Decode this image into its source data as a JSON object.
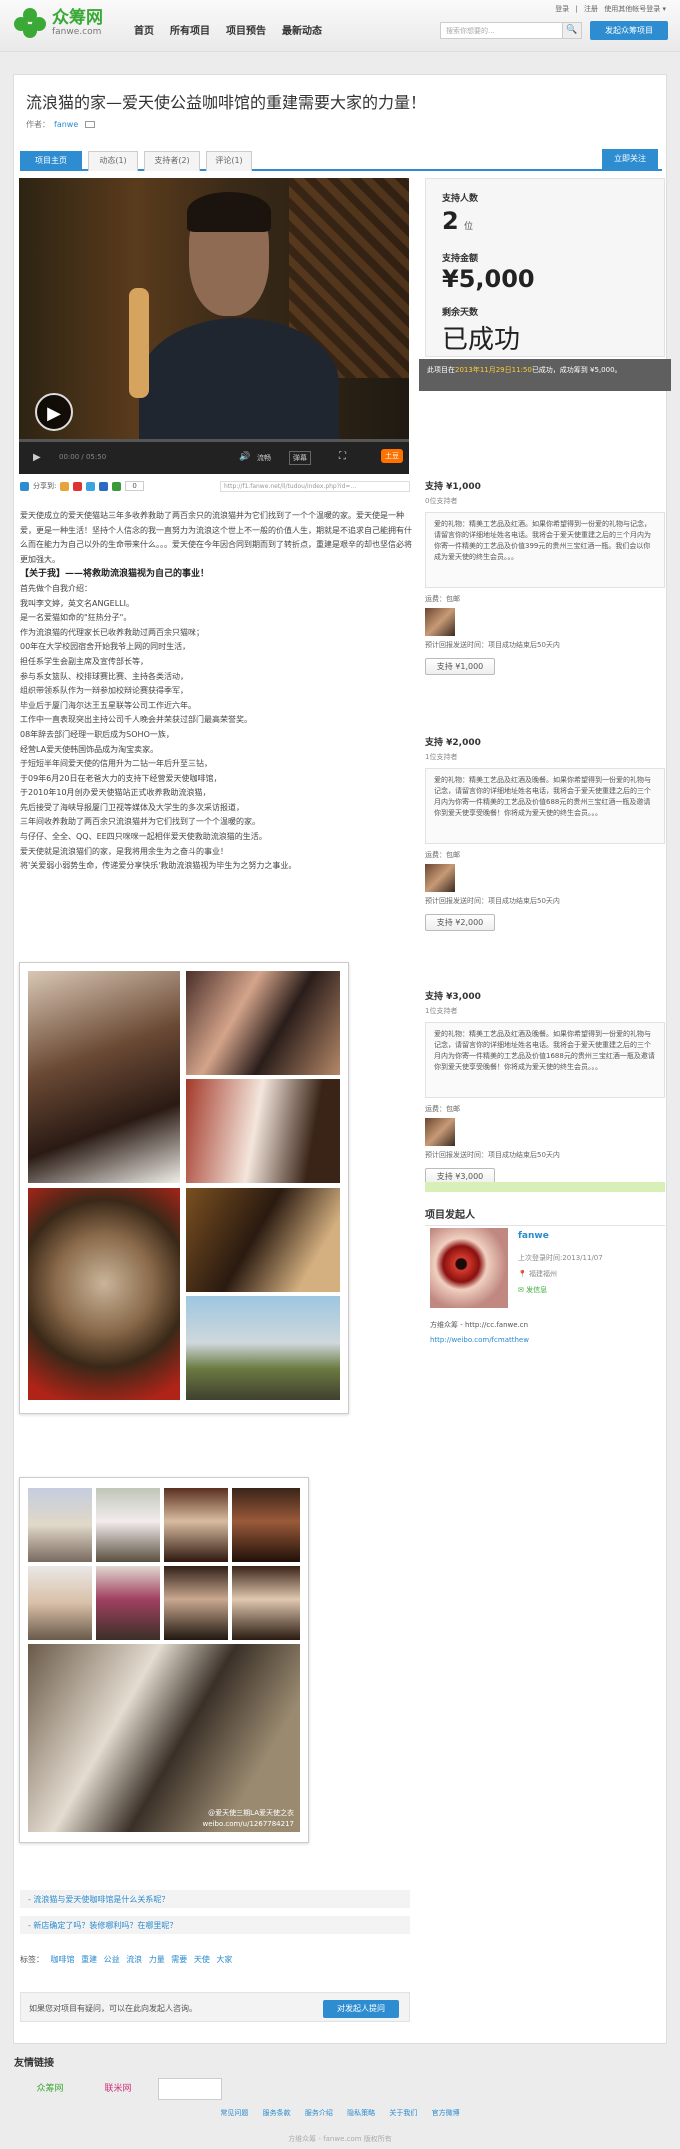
{
  "header": {
    "logo_cn": "众筹网",
    "logo_en": "fanwe.com",
    "nav": [
      "首页",
      "所有项目",
      "项目预告",
      "最新动态"
    ],
    "top_links": [
      "登录",
      "|",
      "注册",
      "使用其他帐号登录 ▾"
    ],
    "search_placeholder": "搜索你想要的...",
    "launch_button": "发起众筹项目"
  },
  "project": {
    "title": "流浪猫的家—爱天使公益咖啡馆的重建需要大家的力量！",
    "author_label": "作者：",
    "author": "fanwe",
    "tabs": [
      "项目主页",
      "动态(1)",
      "支持者(2)",
      "评论(1)"
    ],
    "follow_button": "立即关注",
    "video": {
      "time": "00:00 / 05:50",
      "quality": "流畅",
      "danmu": "弹幕",
      "brand": "土豆"
    },
    "share_label": "分享到:",
    "share_count": "0",
    "url": "http://f1.fanwe.net/ll/tudou/index.php?id=...",
    "story": [
      {
        "text": "爱天使成立的爱天使猫站三年多收养救助了两百余只的流浪猫并为它们找到了一个个温暖的家。爱天使是一种爱，更是一种生活！坚持个人信念的我一直努力为流浪这个世上不一般的价值人生，期就是不追求自己能拥有什么而在能力为自己以外的生命带来什么。。。爱天使在今年因合同到期而到了转折点，重建是艰辛的却也坚信必将更加强大。",
        "bold": false
      },
      {
        "text": "【关于我】——将救助流浪猫视为自己的事业！",
        "bold": true
      },
      {
        "text": "首先做个自我介绍：",
        "bold": false
      },
      {
        "text": "我叫李文婷，英文名ANGELLI。",
        "bold": false
      },
      {
        "text": "是一名爱猫如命的\"狂热分子\"。",
        "bold": false
      },
      {
        "text": "作为流浪猫的代理家长已收养救助过两百余只猫咪；",
        "bold": false
      },
      {
        "text": "00年在大学校园宿舍开始我爷上网的同时生活，",
        "bold": false
      },
      {
        "text": "担任系学生会副主席及宣传部长等，",
        "bold": false
      },
      {
        "text": "参与系女篮队、校排球赛比赛、主持各类活动，",
        "bold": false
      },
      {
        "text": "组织带领系队作为一辩参加校辩论赛获得季军，",
        "bold": false
      },
      {
        "text": "毕业后于厦门海尔达王五星联等公司工作近六年。",
        "bold": false
      },
      {
        "text": "工作中一直表现突出主持公司千人晚会并荣获过部门最高荣誉奖。",
        "bold": false
      },
      {
        "text": "08年辞去部门经理一职后成为SOHO一族，",
        "bold": false
      },
      {
        "text": "经营LA爱天使韩国饰品成为淘宝卖家。",
        "bold": false
      },
      {
        "text": "于短短半年间爱天使的信用升为二钻一年后升至三钻，",
        "bold": false
      },
      {
        "text": "于09年6月20日在老爸大力的支持下经营爱天使咖啡馆，",
        "bold": false
      },
      {
        "text": "于2010年10月创办爱天使猫站正式收养救助流浪猫，",
        "bold": false
      },
      {
        "text": "先后接受了海峡导报厦门卫视等媒体及大学生的多次采访报道，",
        "bold": false
      },
      {
        "text": "三年间收养救助了两百余只流浪猫并为它们找到了一个个温暖的家。",
        "bold": false
      },
      {
        "text": "与仔仔、全全、QQ、EE四只咪咪一起相伴爱天使救助流浪猫的生活。",
        "bold": false
      },
      {
        "text": "爱天使就是流浪猫们的家，是我将用余生为之奋斗的事业！",
        "bold": false
      },
      {
        "text": "将'关爱弱小弱势生命，传递爱分享快乐'救助流浪猫视为毕生为之努力之事业。",
        "bold": false
      }
    ],
    "related_links": [
      "- 流浪猫与爱天使咖啡馆是什么关系呢？",
      "- 新店确定了吗？装修哪利吗？在哪里呢？"
    ],
    "tags_label": "标签：",
    "tags": [
      "咖啡馆",
      "重建",
      "公益",
      "流浪",
      "力量",
      "需要",
      "天使",
      "大家"
    ],
    "contact_text": "如果您对项目有疑问，可以在此向发起人咨询。",
    "contact_button": "对发起人提问",
    "photo_watermark_1": "@爱天使三期LA爱天使之衣",
    "photo_watermark_2": "weibo.com/u/1267784217"
  },
  "stats": {
    "supporters_label": "支持人数",
    "supporters_value": "2",
    "supporters_unit": "位",
    "amount_label": "支持金额",
    "amount_value": "¥5,000",
    "days_label": "剩余天数",
    "days_value": "已成功",
    "notice_prefix": "此项目在",
    "notice_time": "2013年11月29日11:50",
    "notice_suffix": "已成功，成功筹到 ¥5,000。"
  },
  "rewards": [
    {
      "title": "支持 ¥1,000",
      "supporters": "0位支持者",
      "desc": "爱的礼物：精美工艺品及红酒。如果你希望得到一份爱的礼物与记念，请留言你的详细地址姓名电话。我将会于爱天使重建之后的三个月内为你寄一件精美的工艺品及价值399元的贵州三宝红酒一瓶。我们会以你成为爱天使的终生会员。。。",
      "shipping": "运费：包邮",
      "delivery": "预计回报发送时间：项目成功结束后50天内",
      "button": "支持 ¥1,000"
    },
    {
      "title": "支持 ¥2,000",
      "supporters": "1位支持者",
      "desc": "爱的礼物：精美工艺品及红酒及晚餐。如果你希望得到一份爱的礼物与记念，请留言你的详细地址姓名电话，我将会于爱天使重建之后的三个月内为你寄一件精美的工艺品及价值688元的贵州三宝红酒一瓶及邀请你到爱天使享受晚餐！你将成为爱天使的终生会员。。。",
      "shipping": "运费：包邮",
      "delivery": "预计回报发送时间：项目成功结束后50天内",
      "button": "支持 ¥2,000"
    },
    {
      "title": "支持 ¥3,000",
      "supporters": "1位支持者",
      "desc": "爱的礼物：精美工艺品及红酒及晚餐。如果你希望得到一份爱的礼物与记念，请留言你的详细地址姓名电话。我将会于爱天使重建之后的三个月内为你寄一件精美的工艺品及价值1688元的贵州三宝红酒一瓶及邀请你到爱天使享受晚餐！你将成为爱天使的终生会员。。。",
      "shipping": "运费：包邮",
      "delivery": "预计回报发送时间：项目成功结束后50天内",
      "button": "支持 ¥3,000"
    }
  ],
  "sponsor": {
    "section_title": "项目发起人",
    "name": "fanwe",
    "last_login": "上次登录时间:2013/11/07",
    "location": "福建福州",
    "message": "发信息",
    "url": "方维众筹 - http://cc.fanwe.cn",
    "weibo": "http://weibo.com/fcmatthew"
  },
  "footer": {
    "friend_title": "友情链接",
    "friends": [
      "众筹网",
      "联米网"
    ],
    "links": [
      "常见问题",
      "服务条款",
      "服务介绍",
      "隐私策略",
      "关于我们",
      "官方微博"
    ],
    "copyright": "方维众筹 - fanwe.com 版权所有"
  }
}
